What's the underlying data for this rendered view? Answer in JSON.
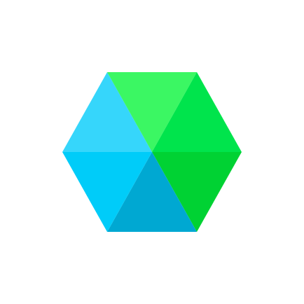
{
  "icon": {
    "name": "hexagon-logo-icon",
    "background": "#ffffff",
    "segments": [
      {
        "name": "top-left-triangle",
        "color": "#36d6fb"
      },
      {
        "name": "top-right-triangle",
        "color": "#3bf763"
      },
      {
        "name": "right-triangle",
        "color": "#00e44c"
      },
      {
        "name": "bottom-right-triangle",
        "color": "#00d233"
      },
      {
        "name": "bottom-left-triangle",
        "color": "#00a8d2"
      },
      {
        "name": "left-triangle",
        "color": "#00ccf9"
      }
    ]
  }
}
